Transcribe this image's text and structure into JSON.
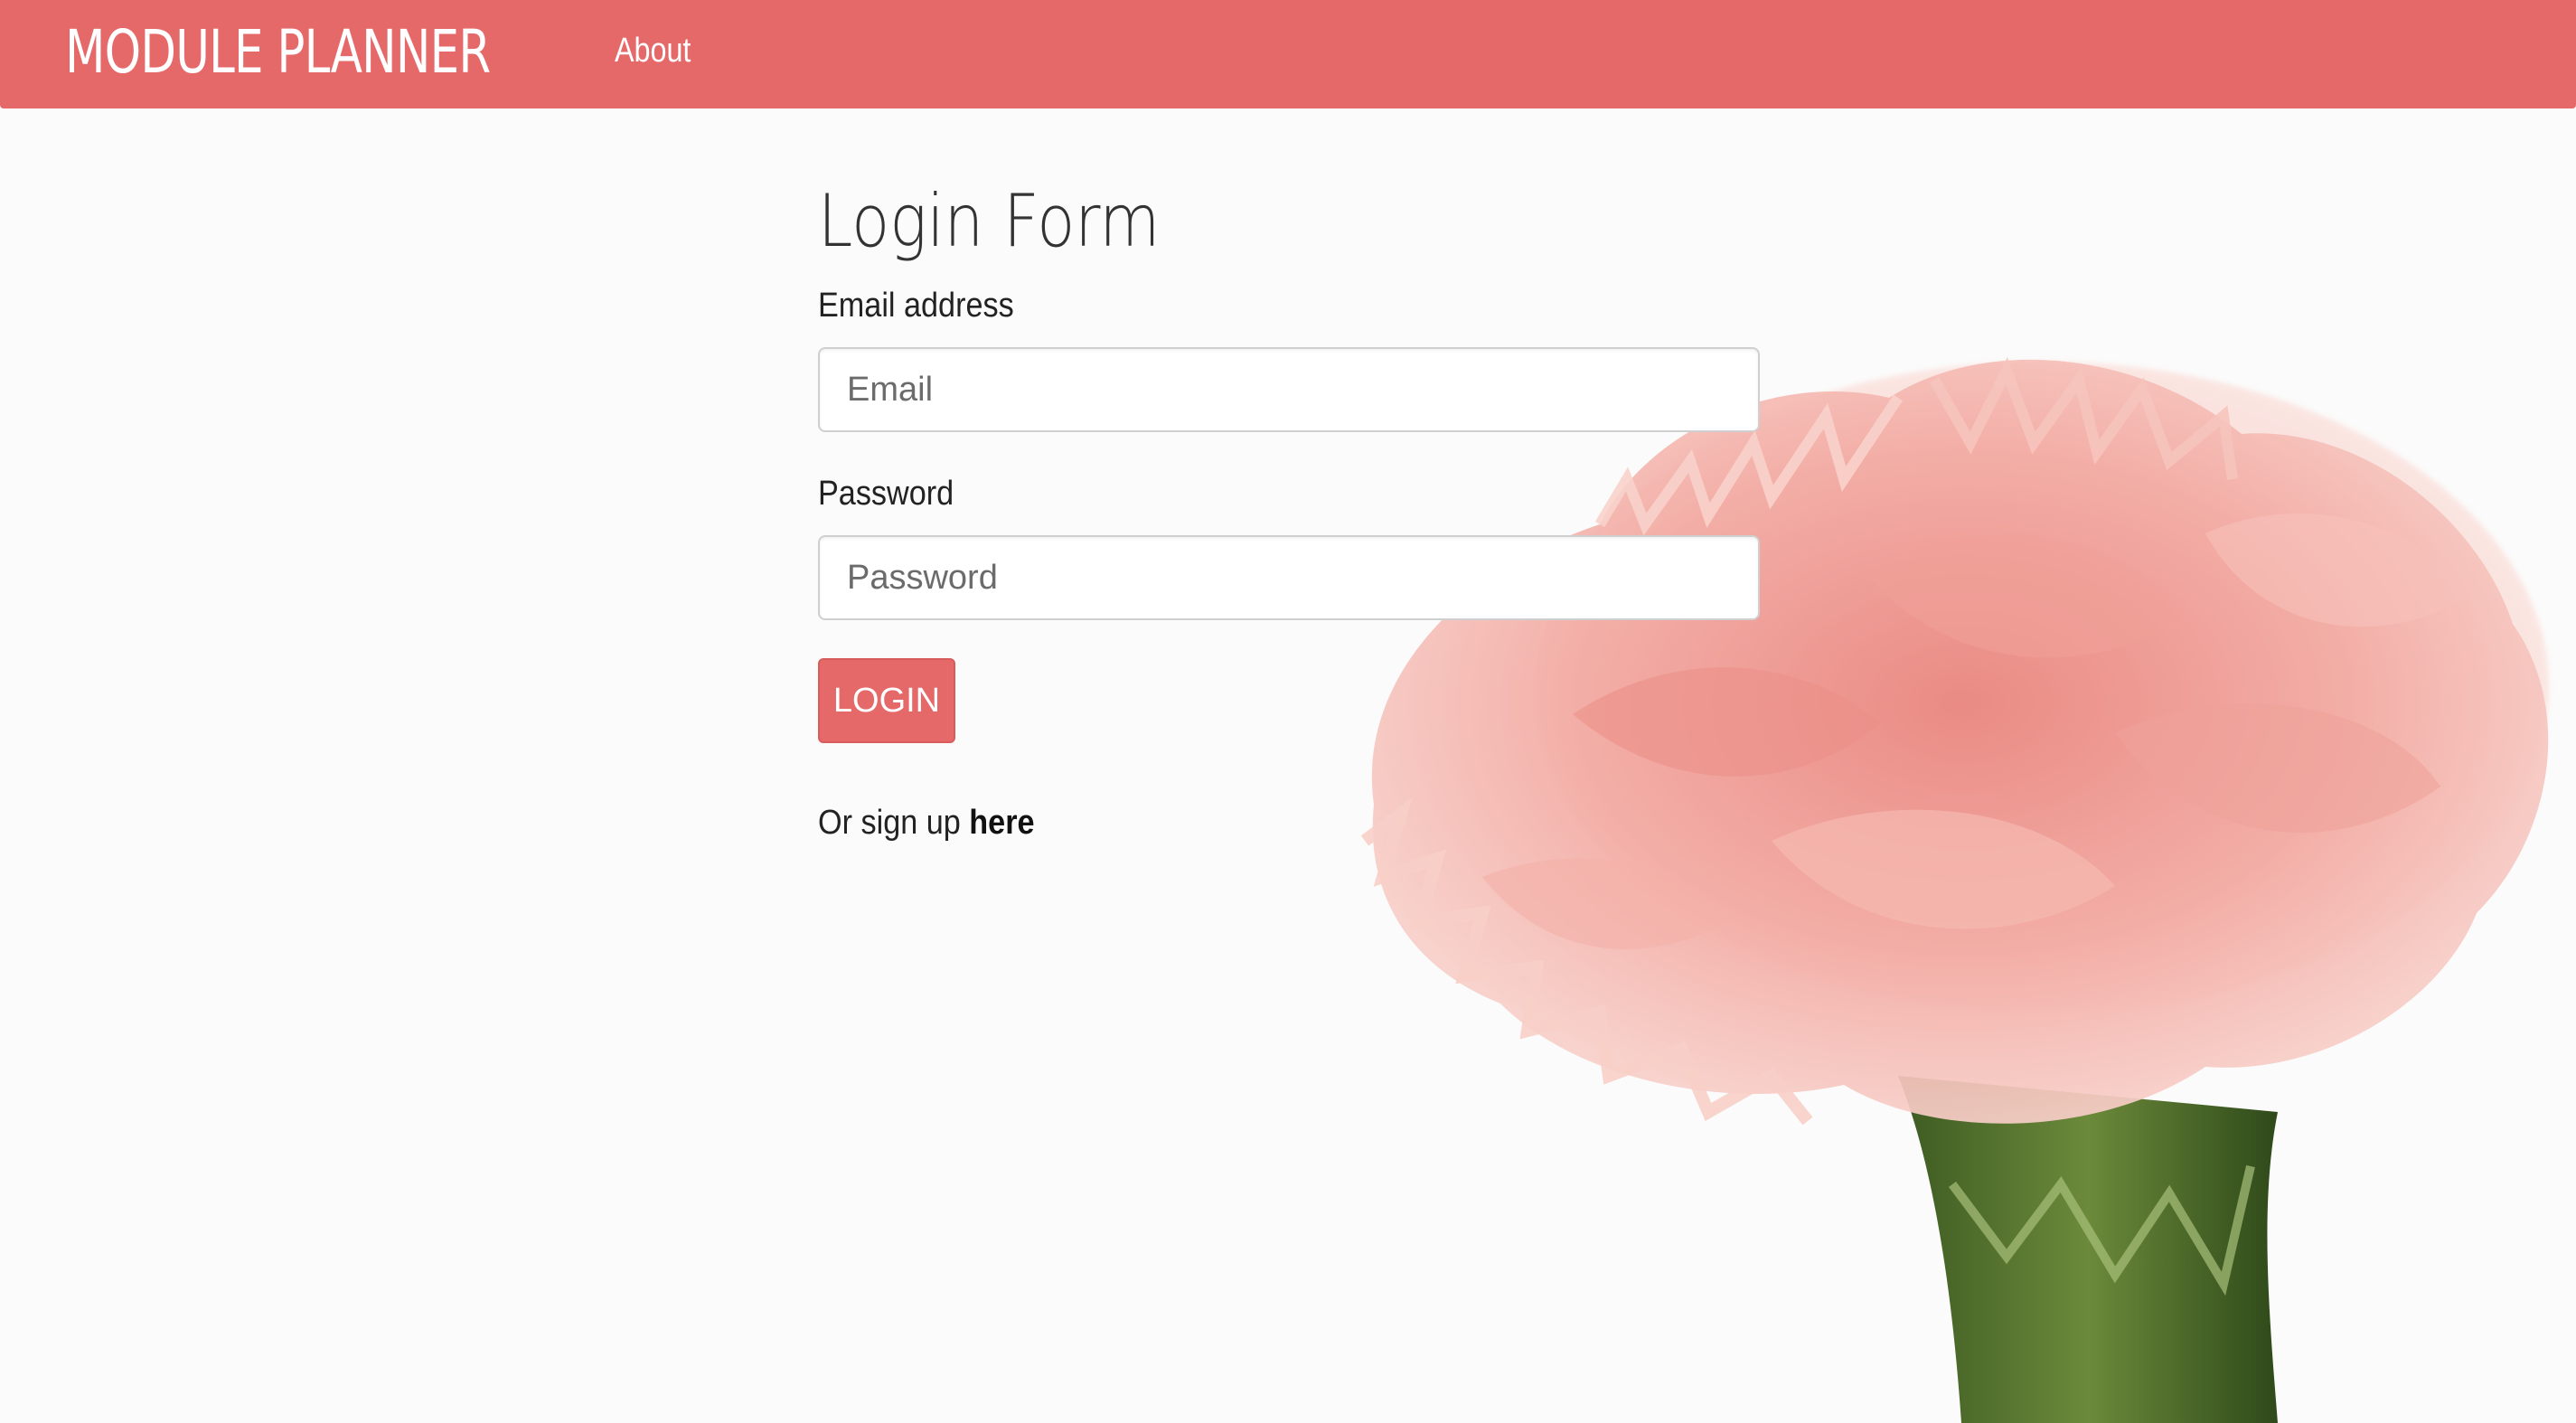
{
  "navbar": {
    "brand": "MODULE PLANNER",
    "links": [
      "About"
    ],
    "color": "#e6696a"
  },
  "form": {
    "title": "Login Form",
    "email_label": "Email address",
    "email_placeholder": "Email",
    "email_value": "",
    "password_label": "Password",
    "password_placeholder": "Password",
    "password_value": "",
    "login_label": "LOGIN",
    "signup_prefix": "Or sign up",
    "signup_link": "here"
  },
  "background": {
    "image": "pink-carnation-flower"
  }
}
